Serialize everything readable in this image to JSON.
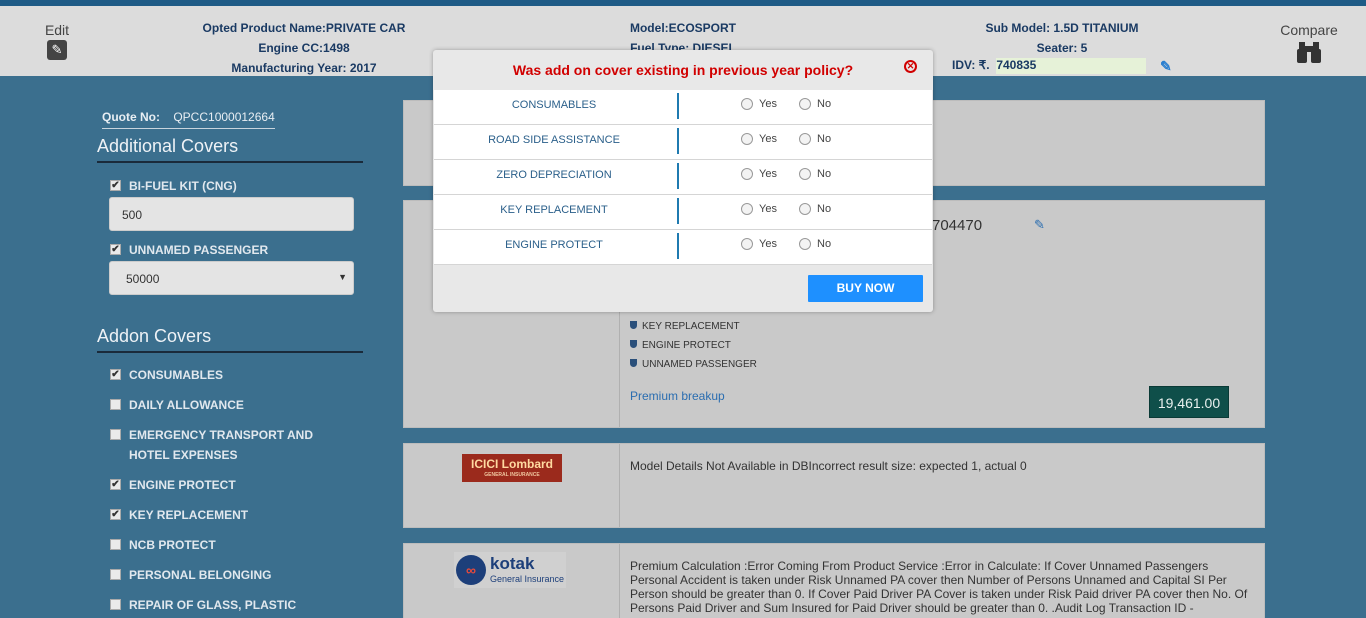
{
  "header": {
    "edit_label": "Edit",
    "compare_label": "Compare",
    "product_name": "Opted Product Name:PRIVATE CAR",
    "engine_cc": "Engine CC:1498",
    "mfg_year": "Manufacturing Year: 2017",
    "model": "Model:ECOSPORT",
    "fuel_type": "Fuel Type: DIESEL",
    "sub_model": "Sub Model: 1.5D TITANIUM",
    "seater": "Seater: 5",
    "idv_label": "IDV: ₹.",
    "idv_value": "740835"
  },
  "sidebar": {
    "quote_label": "Quote No:",
    "quote_value": "QPCC1000012664",
    "additional_title": "Additional Covers",
    "additional": [
      {
        "label": "BI-FUEL KIT (CNG)",
        "checked": true,
        "value": "500"
      },
      {
        "label": "UNNAMED PASSENGER",
        "checked": true,
        "value": "50000"
      }
    ],
    "addon_title": "Addon Covers",
    "addons": [
      {
        "label": "CONSUMABLES",
        "checked": true
      },
      {
        "label": "DAILY ALLOWANCE",
        "checked": false
      },
      {
        "label": "EMERGENCY TRANSPORT AND",
        "label2": "HOTEL EXPENSES",
        "checked": false
      },
      {
        "label": "ENGINE PROTECT",
        "checked": true
      },
      {
        "label": "KEY REPLACEMENT",
        "checked": true
      },
      {
        "label": "NCB PROTECT",
        "checked": false
      },
      {
        "label": "PERSONAL BELONGING",
        "checked": false
      },
      {
        "label": "REPAIR OF GLASS, PLASTIC",
        "checked": false
      }
    ]
  },
  "cards": {
    "card2": {
      "policy_number_partial": "704470",
      "covers": [
        "KEY REPLACEMENT",
        "ENGINE PROTECT",
        "UNNAMED PASSENGER"
      ],
      "premium_link": "Premium breakup",
      "price": "19,461.00"
    },
    "card3": {
      "logo": "ICICI Lombard",
      "logo_sub": "GENERAL INSURANCE",
      "message": "Model Details Not Available in DBIncorrect result size: expected 1, actual 0"
    },
    "card4": {
      "logo_name": "kotak",
      "logo_sub": "General Insurance",
      "message_lines": [
        "Premium Calculation :Error Coming From Product Service :Error in Calculate: If Cover Unnamed Passengers",
        "Personal Accident is taken under Risk Unnamed PA cover then Number of Persons Unnamed and Capital SI Per",
        "Person should be greater than 0. If Cover Paid Driver PA Cover is taken under Risk Paid driver PA cover then No. Of",
        "Persons Paid Driver and Sum Insured for Paid Driver should be greater than 0. .Audit Log Transaction ID -"
      ]
    }
  },
  "modal": {
    "title": "Was add on cover existing in previous year policy?",
    "yes_label": "Yes",
    "no_label": "No",
    "rows": [
      "CONSUMABLES",
      "ROAD SIDE ASSISTANCE",
      "ZERO DEPRECIATION",
      "KEY REPLACEMENT",
      "ENGINE PROTECT"
    ],
    "buy_label": "BUY NOW"
  }
}
